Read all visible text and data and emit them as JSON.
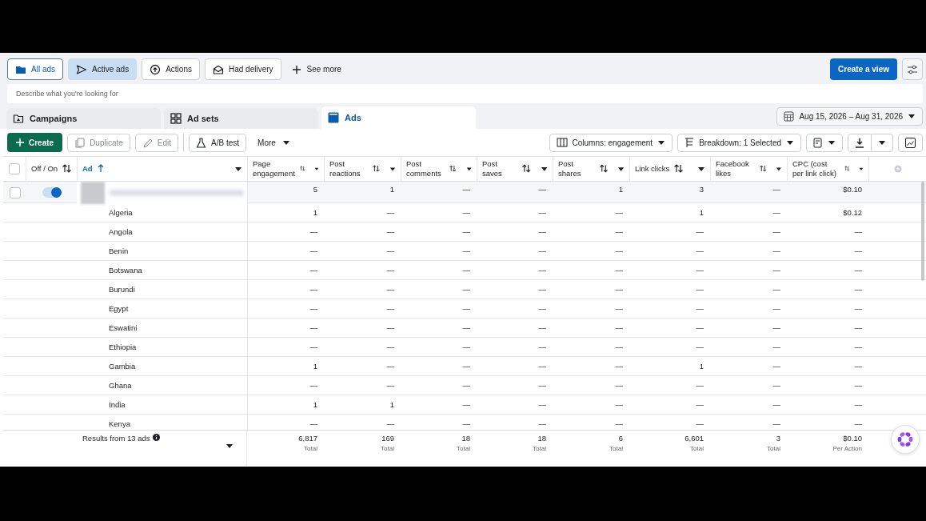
{
  "filters": [
    {
      "label": "All ads",
      "selected": true,
      "applied": false
    },
    {
      "label": "Active ads",
      "selected": false,
      "applied": true
    },
    {
      "label": "Actions",
      "selected": false,
      "applied": false
    },
    {
      "label": "Had delivery",
      "selected": false,
      "applied": false
    }
  ],
  "see_more": "See more",
  "create_view": "Create a view",
  "search": {
    "placeholder": "Describe what you're looking for"
  },
  "tabs": [
    {
      "label": "Campaigns",
      "selected": false
    },
    {
      "label": "Ad sets",
      "selected": false
    },
    {
      "label": "Ads",
      "selected": true
    }
  ],
  "date_range": "Aug 15, 2026 – Aug 31, 2026",
  "toolbar": {
    "create": "Create",
    "duplicate": {
      "label": "Duplicate",
      "disabled": true
    },
    "edit": {
      "label": "Edit",
      "disabled": true
    },
    "ab_test": "A/B test",
    "more": "More",
    "columns": "Columns: engagement",
    "breakdown": "Breakdown: 1 Selected"
  },
  "table": {
    "select_all_checked": false,
    "columns": [
      {
        "label": "Off / On",
        "sorted": false,
        "menu": false
      },
      {
        "label": "Ad",
        "sorted": true,
        "menu": true
      },
      {
        "label": "Page engagement",
        "sorted": false,
        "menu": true
      },
      {
        "label": "Post reactions",
        "sorted": false,
        "menu": true
      },
      {
        "label": "Post comments",
        "sorted": false,
        "menu": true
      },
      {
        "label": "Post saves",
        "sorted": false,
        "menu": true
      },
      {
        "label": "Post shares",
        "sorted": false,
        "menu": true
      },
      {
        "label": "Link clicks",
        "sorted": false,
        "menu": true
      },
      {
        "label": "Facebook likes",
        "sorted": false,
        "menu": true
      },
      {
        "label": "CPC (cost per link click)",
        "sorted": false,
        "menu": true
      }
    ],
    "ad_row": {
      "checked": false,
      "on": true,
      "values": [
        "5",
        "1",
        "—",
        "—",
        "1",
        "3",
        "—",
        "$0.10"
      ]
    },
    "breakdown_rows": [
      {
        "name": "Algeria",
        "values": [
          "1",
          "—",
          "—",
          "—",
          "—",
          "1",
          "—",
          "$0.12"
        ]
      },
      {
        "name": "Angola",
        "values": [
          "—",
          "—",
          "—",
          "—",
          "—",
          "—",
          "—",
          "—"
        ]
      },
      {
        "name": "Benin",
        "values": [
          "—",
          "—",
          "—",
          "—",
          "—",
          "—",
          "—",
          "—"
        ]
      },
      {
        "name": "Botswana",
        "values": [
          "—",
          "—",
          "—",
          "—",
          "—",
          "—",
          "—",
          "—"
        ]
      },
      {
        "name": "Burundi",
        "values": [
          "—",
          "—",
          "—",
          "—",
          "—",
          "—",
          "—",
          "—"
        ]
      },
      {
        "name": "Egypt",
        "values": [
          "—",
          "—",
          "—",
          "—",
          "—",
          "—",
          "—",
          "—"
        ]
      },
      {
        "name": "Eswatini",
        "values": [
          "—",
          "—",
          "—",
          "—",
          "—",
          "—",
          "—",
          "—"
        ]
      },
      {
        "name": "Ethiopia",
        "values": [
          "—",
          "—",
          "—",
          "—",
          "—",
          "—",
          "—",
          "—"
        ]
      },
      {
        "name": "Gambia",
        "values": [
          "1",
          "—",
          "—",
          "—",
          "—",
          "1",
          "—",
          "—"
        ]
      },
      {
        "name": "Ghana",
        "values": [
          "—",
          "—",
          "—",
          "—",
          "—",
          "—",
          "—",
          "—"
        ]
      },
      {
        "name": "India",
        "values": [
          "1",
          "1",
          "—",
          "—",
          "—",
          "—",
          "—",
          "—"
        ]
      },
      {
        "name": "Kenya",
        "values": [
          "—",
          "—",
          "—",
          "—",
          "—",
          "—",
          "—",
          "—"
        ]
      }
    ],
    "footer": {
      "label": "Results from 13 ads",
      "totals": [
        {
          "value": "6,817",
          "unit": "Total"
        },
        {
          "value": "169",
          "unit": "Total"
        },
        {
          "value": "18",
          "unit": "Total"
        },
        {
          "value": "18",
          "unit": "Total"
        },
        {
          "value": "6",
          "unit": "Total"
        },
        {
          "value": "6,601",
          "unit": "Total"
        },
        {
          "value": "3",
          "unit": "Total"
        },
        {
          "value": "$0.10",
          "unit": "Per Action"
        }
      ]
    }
  }
}
